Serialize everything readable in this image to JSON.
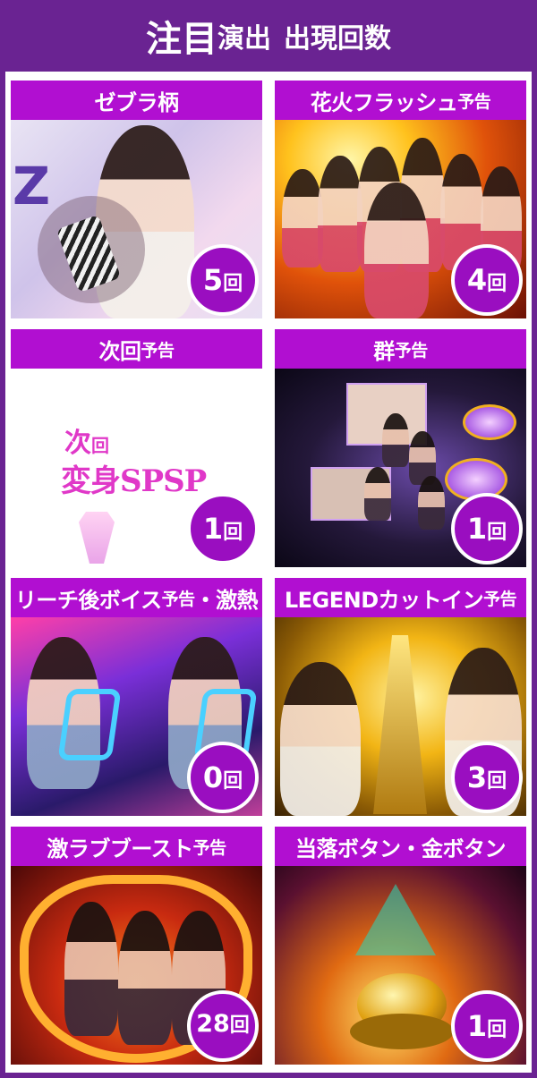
{
  "header": {
    "part1": "注目",
    "part2": "演出",
    "part3": "出現",
    "part4": "回数"
  },
  "colors": {
    "frame": "#6a2392",
    "label_bg": "#b10fd1",
    "badge_bg": "#9a0ec0"
  },
  "cards": [
    {
      "label": "ゼブラ柄",
      "label_small": "",
      "count": "5",
      "unit": "回"
    },
    {
      "label": "花火フラッシュ",
      "label_small": "予告",
      "count": "4",
      "unit": "回"
    },
    {
      "label": "次回",
      "label_small": "予告",
      "count": "1",
      "unit": "回"
    },
    {
      "label": "群",
      "label_small": "予告",
      "count": "1",
      "unit": "回"
    },
    {
      "label": "リーチ後ボイス",
      "label_small": "予告",
      "label_tail": "・激熱",
      "count": "0",
      "unit": "回"
    },
    {
      "label": "LEGENDカットイン",
      "label_small": "予告",
      "count": "3",
      "unit": "回"
    },
    {
      "label": "激ラブブースト",
      "label_small": "予告",
      "count": "28",
      "unit": "回"
    },
    {
      "label": "当落ボタン・金ボタン",
      "label_small": "",
      "count": "1",
      "unit": "回"
    }
  ],
  "jikai_image": {
    "line1": "次",
    "line1_small": "回",
    "line2": "変身SPSP"
  }
}
